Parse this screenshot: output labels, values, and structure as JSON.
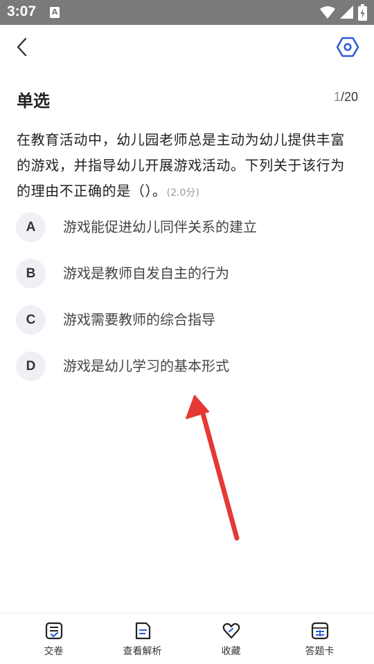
{
  "status_bar": {
    "time": "3:07",
    "notif_icon_letter": "A"
  },
  "header": {
    "back_icon": "chevron-left-icon",
    "settings_icon": "hexagon-settings-icon"
  },
  "question": {
    "type": "单选",
    "progress_current": "1",
    "progress_total": "/20",
    "text": "在教育活动中，幼儿园老师总是主动为幼儿提供丰富的游戏，并指导幼儿开展游戏活动。下列关于该行为的理由不正确的是（）。",
    "score": "(2.0分)"
  },
  "options": [
    {
      "letter": "A",
      "text": "游戏能促进幼儿同伴关系的建立"
    },
    {
      "letter": "B",
      "text": "游戏是教师自发自主的行为"
    },
    {
      "letter": "C",
      "text": "游戏需要教师的综合指导"
    },
    {
      "letter": "D",
      "text": "游戏是幼儿学习的基本形式"
    }
  ],
  "annotation": {
    "arrow_color": "#e53935"
  },
  "bottom_tabs": [
    {
      "label": "交卷",
      "icon": "submit-paper-icon"
    },
    {
      "label": "查看解析",
      "icon": "document-analysis-icon"
    },
    {
      "label": "收藏",
      "icon": "heart-favorite-icon"
    },
    {
      "label": "答题卡",
      "icon": "answer-card-icon"
    }
  ],
  "colors": {
    "accent": "#2f5bd8",
    "badge_bg": "#eef0f6",
    "status_bar": "#7a7a7a"
  }
}
